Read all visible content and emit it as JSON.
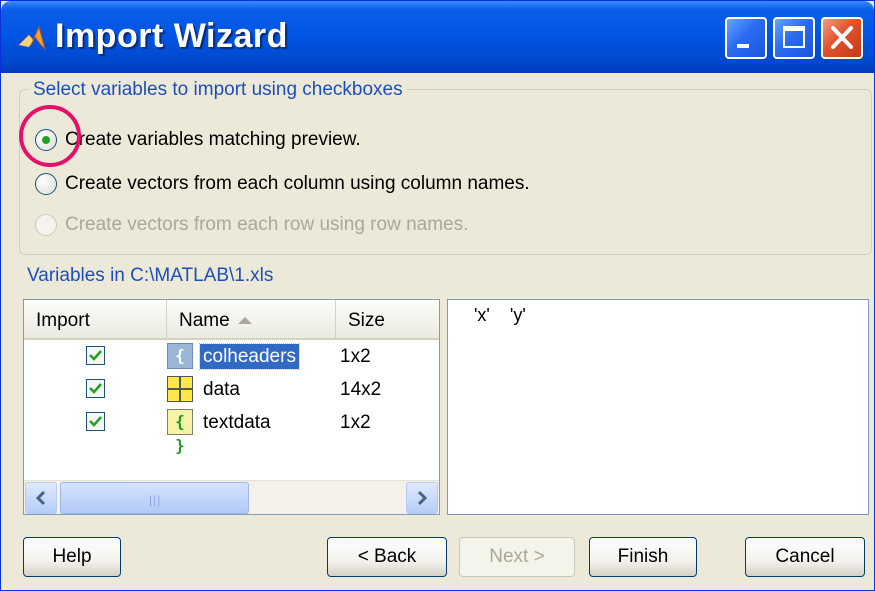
{
  "window": {
    "title": "Import Wizard",
    "controls": [
      "minimize-icon",
      "maximize-icon",
      "close-icon"
    ]
  },
  "options_group": {
    "legend": "Select variables to import using checkboxes",
    "options": [
      {
        "label": "Create variables matching preview.",
        "checked": true,
        "enabled": true
      },
      {
        "label": "Create vectors from each column using column names.",
        "checked": false,
        "enabled": true
      },
      {
        "label": "Create vectors from each row using row names.",
        "checked": false,
        "enabled": false
      }
    ]
  },
  "variables": {
    "label": "Variables in C:\\MATLAB\\1.xls",
    "columns": [
      "Import",
      "Name",
      "Size"
    ],
    "sort_column": "Name",
    "rows": [
      {
        "import": true,
        "icon": "cell-array-icon",
        "icon_glyph": "{ }",
        "name": "colheaders",
        "size": "1x2",
        "selected": true
      },
      {
        "import": true,
        "icon": "matrix-icon",
        "icon_glyph": "",
        "name": "data",
        "size": "14x2",
        "selected": false
      },
      {
        "import": true,
        "icon": "cell-array-icon",
        "icon_glyph": "{ }",
        "name": "textdata",
        "size": "1x2",
        "selected": false
      }
    ]
  },
  "preview": {
    "text": "'x'    'y'"
  },
  "buttons": {
    "help": "Help",
    "back": "< Back",
    "next": "Next >",
    "finish": "Finish",
    "cancel": "Cancel"
  },
  "colors": {
    "title_bar": "#0054e3",
    "dialog_bg": "#ece9d8",
    "group_label": "#1e4fb8",
    "annotation_circle": "#e5106b",
    "selection": "#316ac5"
  }
}
